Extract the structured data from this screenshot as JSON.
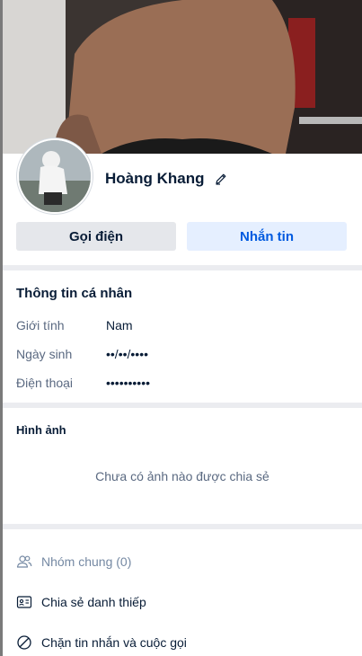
{
  "profile": {
    "name": "Hoàng Khang"
  },
  "buttons": {
    "call_label": "Gọi điện",
    "message_label": "Nhắn tin"
  },
  "personal_info": {
    "title": "Thông tin cá nhân",
    "gender_label": "Giới tính",
    "gender_value": "Nam",
    "birthday_label": "Ngày sinh",
    "birthday_value": "••/••/••••",
    "phone_label": "Điện thoại",
    "phone_value": "••••••••••"
  },
  "photos": {
    "title": "Hình ảnh",
    "empty_text": "Chưa có ảnh nào được chia sẻ"
  },
  "actions": {
    "common_groups": "Nhóm chung (0)",
    "share_card": "Chia sẻ danh thiếp",
    "block": "Chặn tin nhắn và cuộc gọi"
  },
  "colors": {
    "accent": "#005ae0",
    "accent_bg": "#e5efff",
    "divider": "#ebecf0"
  },
  "icons": {
    "edit": "pencil-icon",
    "groups": "users-icon",
    "share": "id-card-icon",
    "block": "block-icon"
  }
}
